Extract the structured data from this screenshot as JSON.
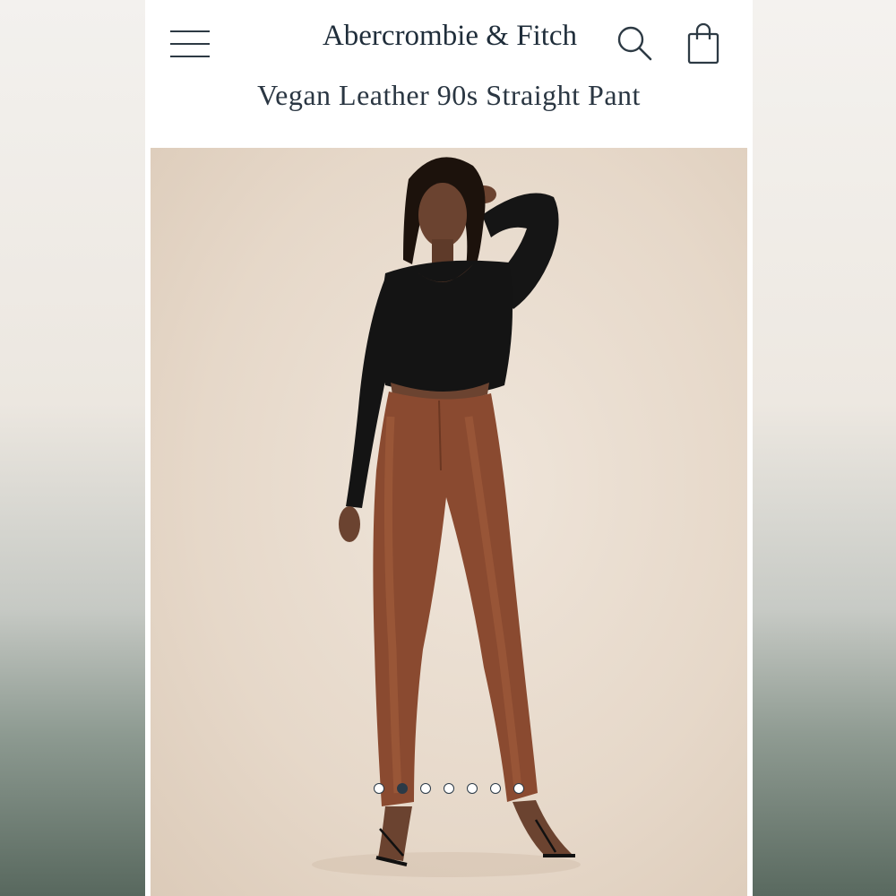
{
  "header": {
    "brand": "Abercrombie & Fitch",
    "title": "Vegan Leather 90s Straight Pant",
    "menu_icon": "hamburger-menu-icon",
    "search_icon": "search-icon",
    "bag_icon": "shopping-bag-icon"
  },
  "product_image": {
    "description_icon": "product-photo",
    "colors": {
      "background": "#e6d8c9",
      "top": "#141414",
      "pants": "#8a4a30",
      "skin": "#6b4330"
    }
  },
  "carousel": {
    "total": 7,
    "active_index": 1
  },
  "colors": {
    "brand_navy": "#1f2d3a",
    "surround_top": "#ece7e0",
    "surround_bottom": "#58685e"
  }
}
